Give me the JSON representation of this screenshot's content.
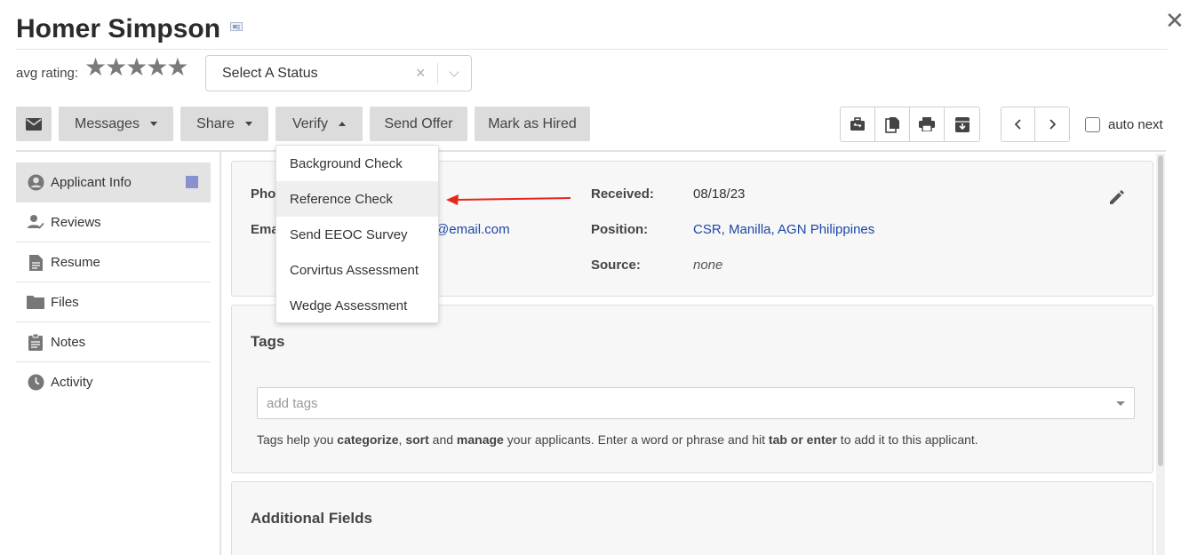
{
  "header": {
    "title": "Homer Simpson",
    "close_label": "✕",
    "rating_label": "avg rating:",
    "stars": "★★★★★",
    "status_placeholder": "Select A Status",
    "status_clear": "×"
  },
  "toolbar": {
    "messages_label": "Messages",
    "share_label": "Share",
    "verify_label": "Verify",
    "send_offer_label": "Send Offer",
    "mark_hired_label": "Mark as Hired",
    "auto_next_label": "auto next"
  },
  "sidebar": {
    "items": [
      {
        "label": "Applicant Info",
        "icon": "account-circle-icon"
      },
      {
        "label": "Reviews",
        "icon": "person-check-icon"
      },
      {
        "label": "Resume",
        "icon": "document-icon"
      },
      {
        "label": "Files",
        "icon": "folder-icon"
      },
      {
        "label": "Notes",
        "icon": "clipboard-icon"
      },
      {
        "label": "Activity",
        "icon": "clock-icon"
      }
    ]
  },
  "info": {
    "phone_label": "Pho",
    "email_label": "Ema",
    "email_value": "@email.com",
    "received_label": "Received:",
    "received_value": "08/18/23",
    "position_label": "Position:",
    "position_value": "CSR, Manilla, AGN Philippines",
    "source_label": "Source:",
    "source_value": "none"
  },
  "tags": {
    "title": "Tags",
    "placeholder": "add tags",
    "help_parts": [
      "Tags help you ",
      "categorize",
      ", ",
      "sort",
      " and ",
      "manage",
      " your applicants. Enter a word or phrase and hit ",
      "tab or enter",
      " to add it to this applicant."
    ]
  },
  "additional": {
    "title": "Additional Fields"
  },
  "verify_menu": {
    "items": [
      "Background Check",
      "Reference Check",
      "Send EEOC Survey",
      "Corvirtus Assessment",
      "Wedge Assessment"
    ],
    "highlighted": "Reference Check"
  },
  "colors": {
    "accent_link": "#1d47a8",
    "badge": "#8791d0",
    "annotation_arrow": "#e8241b",
    "button_bg": "#dcdcdc"
  }
}
